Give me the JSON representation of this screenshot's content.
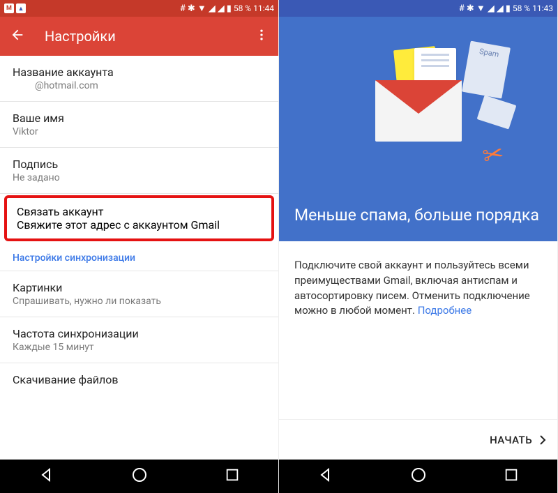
{
  "left": {
    "statusbar": {
      "battery": "58 %",
      "time": "11:44"
    },
    "appbar": {
      "title": "Настройки"
    },
    "items": {
      "account_name": {
        "label": "Название аккаунта",
        "value": "@hotmail.com"
      },
      "your_name": {
        "label": "Ваше имя",
        "value": "Viktor"
      },
      "signature": {
        "label": "Подпись",
        "value": "Не задано"
      },
      "link_account": {
        "label": "Связать аккаунт",
        "value": "Свяжите этот адрес с аккаунтом Gmail"
      },
      "sync_section": "Настройки синхронизации",
      "images": {
        "label": "Картинки",
        "value": "Спрашивать, нужно ли показать"
      },
      "sync_freq": {
        "label": "Частота синхронизации",
        "value": "Каждые 15 минут"
      },
      "download": {
        "label": "Скачивание файлов"
      }
    }
  },
  "right": {
    "statusbar": {
      "battery": "58 %",
      "time": "11:43"
    },
    "hero": {
      "title": "Меньше спама, больше порядка",
      "spam_label": "Spam"
    },
    "body_text": "Подключите свой аккаунт и пользуйтесь всеми преимуществами Gmail, включая антиспам и автосортировку писем. Отменить подключение можно в любой момент. ",
    "learn_more": "Подробнее",
    "start": "НАЧАТЬ"
  }
}
